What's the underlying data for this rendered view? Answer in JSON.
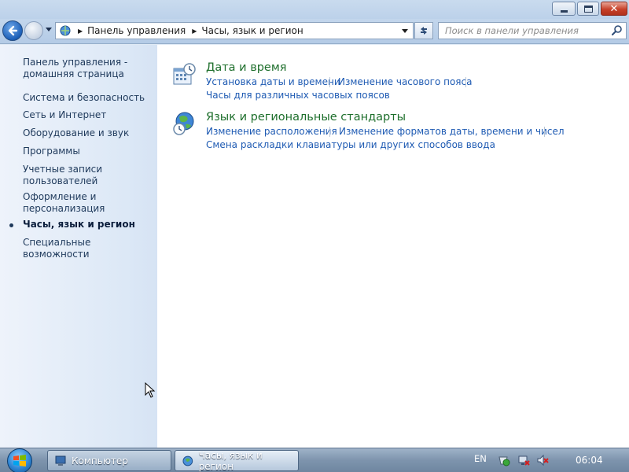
{
  "window": {
    "controls": {
      "minimize": "minimize-icon",
      "maximize": "maximize-icon",
      "close": "close-icon"
    }
  },
  "address_bar": {
    "breadcrumbs": [
      "Панель управления",
      "Часы, язык и регион"
    ],
    "search_placeholder": "Поиск в панели управления"
  },
  "sidebar": {
    "items": [
      {
        "label": "Панель управления - домашняя страница",
        "active": false
      },
      {
        "label": "Система и безопасность",
        "active": false
      },
      {
        "label": "Сеть и Интернет",
        "active": false
      },
      {
        "label": "Оборудование и звук",
        "active": false
      },
      {
        "label": "Программы",
        "active": false
      },
      {
        "label": "Учетные записи пользователей",
        "active": false
      },
      {
        "label": "Оформление и персонализация",
        "active": false
      },
      {
        "label": "Часы, язык и регион",
        "active": true
      },
      {
        "label": "Специальные возможности",
        "active": false
      }
    ]
  },
  "main": {
    "categories": [
      {
        "title": "Дата и время",
        "icon": "calendar-clock-icon",
        "links": [
          "Установка даты и времени",
          "Изменение часового пояса",
          "Часы для различных часовых поясов"
        ]
      },
      {
        "title": "Язык и региональные стандарты",
        "icon": "globe-clock-icon",
        "links": [
          "Изменение расположения",
          "Изменение форматов даты, времени и чисел",
          "Смена раскладки клавиатуры или других способов ввода"
        ]
      }
    ]
  },
  "taskbar": {
    "buttons": [
      "Компьютер",
      "Часы, язык и регион"
    ],
    "language": "EN",
    "clock": "06:04"
  },
  "colors": {
    "category_title": "#1e6f2c",
    "link": "#1f5bb3",
    "sidebar_text": "#1e395b"
  }
}
